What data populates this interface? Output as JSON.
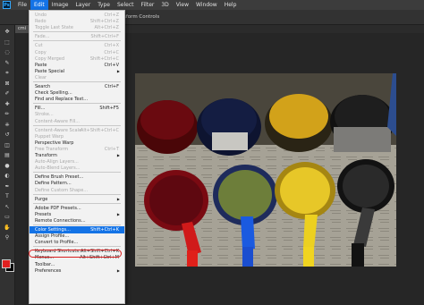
{
  "app": {
    "logo_text": "Ps"
  },
  "menubar": [
    "File",
    "Edit",
    "Image",
    "Layer",
    "Type",
    "Select",
    "Filter",
    "3D",
    "View",
    "Window",
    "Help"
  ],
  "options_bar": {
    "transform_controls_label": "sform Controls"
  },
  "document_tab": {
    "label": "cmi"
  },
  "colors": {
    "foreground": "#e02020",
    "background": "#000000",
    "highlight": "#1473e6",
    "annotation_ring": "#d81e1e"
  },
  "edit_menu": [
    {
      "label": "Undo",
      "shortcut": "Ctrl+Z",
      "disabled": true
    },
    {
      "label": "Redo",
      "shortcut": "Shift+Ctrl+Z",
      "disabled": true
    },
    {
      "label": "Toggle Last State",
      "shortcut": "Alt+Ctrl+Z",
      "disabled": true
    },
    {
      "sep": true
    },
    {
      "label": "Fade...",
      "shortcut": "Shift+Ctrl+F",
      "disabled": true
    },
    {
      "sep": true
    },
    {
      "label": "Cut",
      "shortcut": "Ctrl+X",
      "disabled": true
    },
    {
      "label": "Copy",
      "shortcut": "Ctrl+C",
      "disabled": true
    },
    {
      "label": "Copy Merged",
      "shortcut": "Shift+Ctrl+C",
      "disabled": true
    },
    {
      "label": "Paste",
      "shortcut": "Ctrl+V"
    },
    {
      "label": "Paste Special",
      "submenu": true
    },
    {
      "label": "Clear",
      "disabled": true
    },
    {
      "sep": true
    },
    {
      "label": "Search",
      "shortcut": "Ctrl+F"
    },
    {
      "label": "Check Spelling..."
    },
    {
      "label": "Find and Replace Text..."
    },
    {
      "sep": true
    },
    {
      "label": "Fill...",
      "shortcut": "Shift+F5"
    },
    {
      "label": "Stroke...",
      "disabled": true
    },
    {
      "label": "Content-Aware Fill...",
      "disabled": true
    },
    {
      "sep": true
    },
    {
      "label": "Content-Aware Scale",
      "shortcut": "Alt+Shift+Ctrl+C",
      "disabled": true
    },
    {
      "label": "Puppet Warp",
      "disabled": true
    },
    {
      "label": "Perspective Warp"
    },
    {
      "label": "Free Transform",
      "shortcut": "Ctrl+T",
      "disabled": true
    },
    {
      "label": "Transform",
      "submenu": true
    },
    {
      "label": "Auto-Align Layers...",
      "disabled": true
    },
    {
      "label": "Auto-Blend Layers...",
      "disabled": true
    },
    {
      "sep": true
    },
    {
      "label": "Define Brush Preset..."
    },
    {
      "label": "Define Pattern..."
    },
    {
      "label": "Define Custom Shape...",
      "disabled": true
    },
    {
      "sep": true
    },
    {
      "label": "Purge",
      "submenu": true
    },
    {
      "sep": true
    },
    {
      "label": "Adobe PDF Presets..."
    },
    {
      "label": "Presets",
      "submenu": true
    },
    {
      "label": "Remote Connections..."
    },
    {
      "sep": true
    },
    {
      "label": "Color Settings...",
      "shortcut": "Shift+Ctrl+K",
      "highlighted": true
    },
    {
      "label": "Assign Profile..."
    },
    {
      "label": "Convert to Profile..."
    },
    {
      "sep": true
    },
    {
      "label": "Keyboard Shortcuts...",
      "shortcut": "Alt+Shift+Ctrl+K"
    },
    {
      "label": "Menus...",
      "shortcut": "Alt+Shift+Ctrl+M"
    },
    {
      "label": "Toolbar..."
    },
    {
      "label": "Preferences",
      "submenu": true
    }
  ],
  "toolbar_icons": [
    "move-icon",
    "marquee-icon",
    "lasso-icon",
    "quick-select-icon",
    "crop-icon",
    "frame-icon",
    "eyedropper-icon",
    "healing-icon",
    "brush-icon",
    "clone-stamp-icon",
    "history-brush-icon",
    "eraser-icon",
    "gradient-icon",
    "blur-icon",
    "dodge-icon",
    "pen-icon",
    "type-icon",
    "path-select-icon",
    "rectangle-icon",
    "hand-icon",
    "zoom-icon"
  ]
}
